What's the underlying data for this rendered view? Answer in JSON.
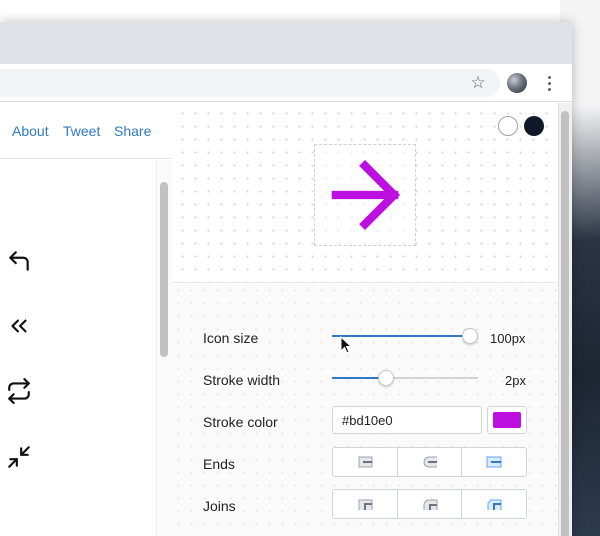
{
  "nav": {
    "about": "About",
    "tweet": "Tweet",
    "share": "Share"
  },
  "sidebar": {
    "icons": [
      "corner-up-left-icon",
      "chevrons-left-icon",
      "repeat-icon",
      "minimize-2-icon"
    ]
  },
  "preview": {
    "icon": "arrow-right-icon"
  },
  "controls": {
    "icon_size": {
      "label": "Icon size",
      "value": "100px",
      "fraction": 1.0
    },
    "stroke_width": {
      "label": "Stroke width",
      "value": "2px",
      "fraction": 0.35
    },
    "stroke_color": {
      "label": "Stroke color",
      "hex": "#bd10e0"
    },
    "ends": {
      "label": "Ends",
      "options": [
        "butt-cap-icon",
        "round-cap-icon",
        "square-cap-icon"
      ]
    },
    "joins": {
      "label": "Joins",
      "options": [
        "miter-join-icon",
        "round-join-icon",
        "bevel-join-icon"
      ]
    }
  },
  "colors": {
    "accent": "#2f7ac4",
    "stroke": "#bd10e0",
    "link": "#2f7ac4"
  }
}
